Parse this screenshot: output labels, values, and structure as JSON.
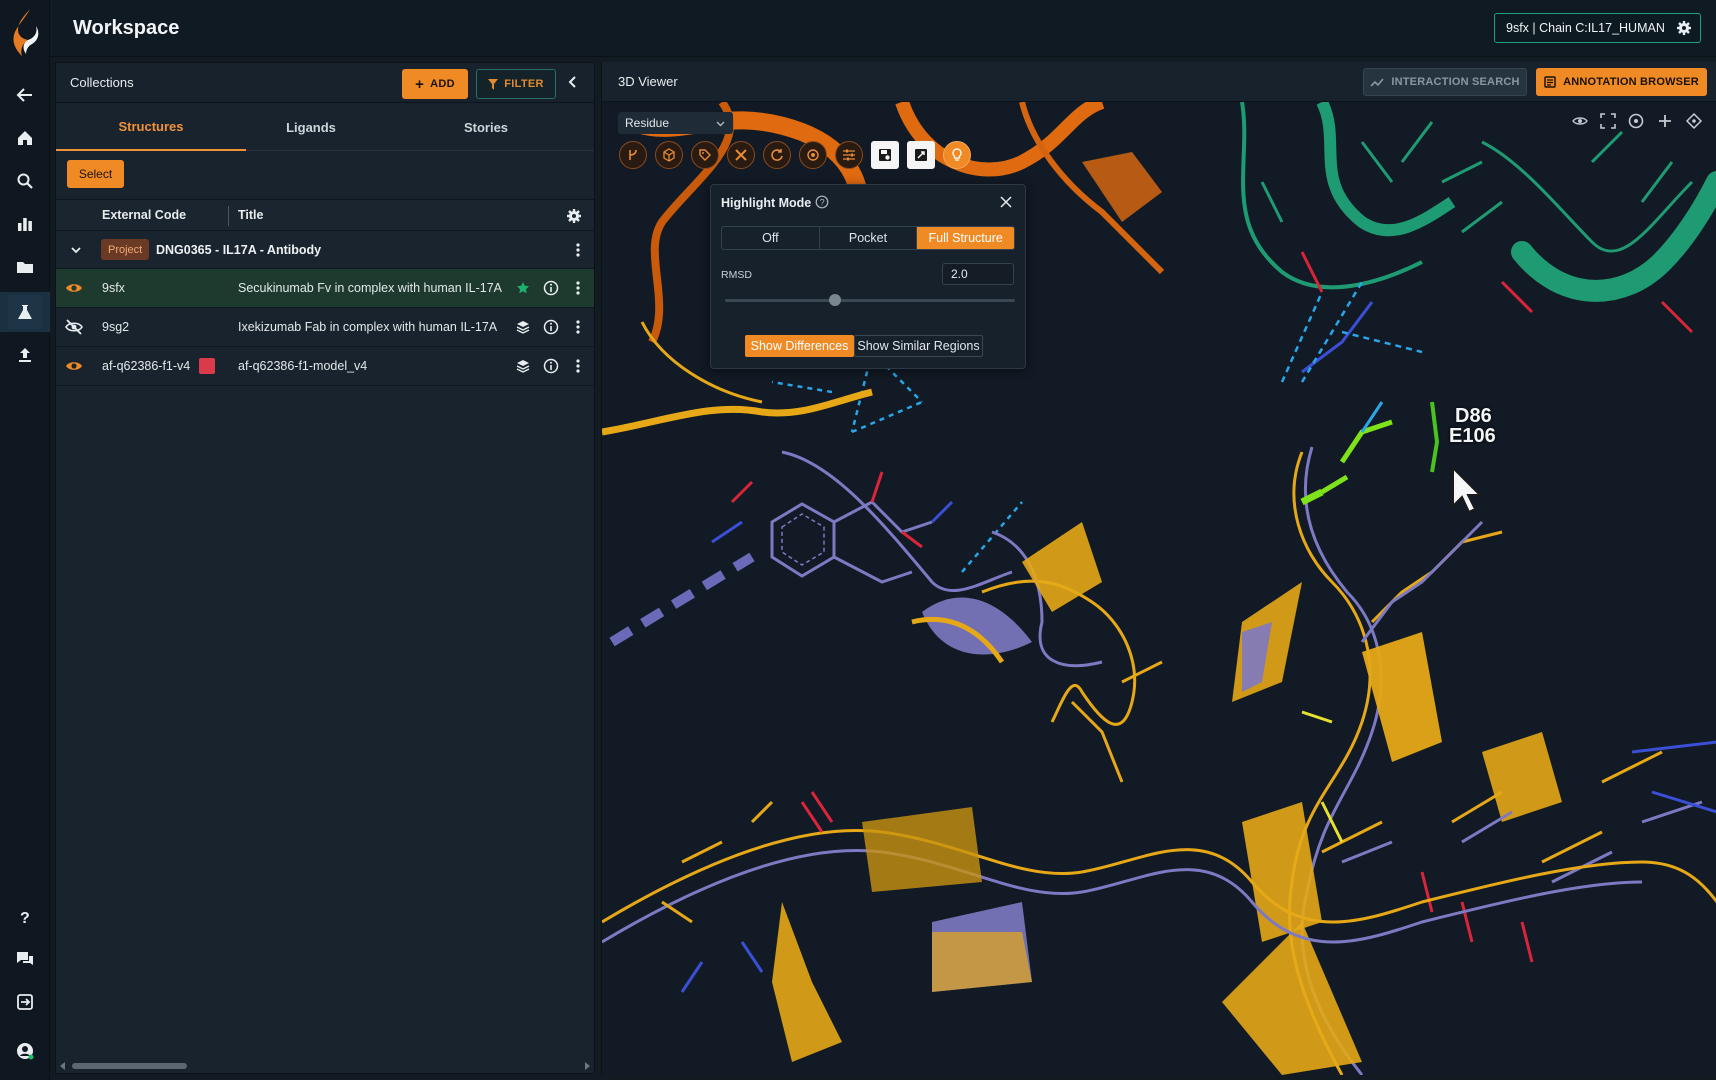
{
  "header": {
    "title": "Workspace",
    "context_badge": "9sfx | Chain C:IL17_HUMAN"
  },
  "collections": {
    "title": "Collections",
    "add_label": "ADD",
    "filter_label": "FILTER",
    "tabs": [
      "Structures",
      "Ligands",
      "Stories"
    ],
    "active_tab": "Structures",
    "select_label": "Select",
    "columns": {
      "external_code": "External Code",
      "title": "Title"
    },
    "project": {
      "tag": "Project",
      "name": "DNG0365 - IL17A - Antibody"
    },
    "rows": [
      {
        "code": "9sfx",
        "title": "Secukinumab Fv in complex with human IL-17A",
        "visible": true,
        "starred": true,
        "selected": true
      },
      {
        "code": "9sg2",
        "title": "Ixekizumab Fab in complex with human IL-17A",
        "visible": false,
        "starred": false,
        "selected": false
      },
      {
        "code": "af-q62386-f1-v4",
        "title": "af-q62386-f1-model_v4",
        "visible": true,
        "starred": false,
        "selected": false,
        "model_icon": true
      }
    ]
  },
  "viewer": {
    "title": "3D Viewer",
    "interaction_search_label": "INTERACTION SEARCH",
    "annotation_browser_label": "ANNOTATION BROWSER",
    "selection_mode": "Residue",
    "residue_labels": [
      "D86",
      "E106"
    ]
  },
  "highlight_mode": {
    "title": "Highlight Mode",
    "options": [
      "Off",
      "Pocket",
      "Full Structure"
    ],
    "active_option": "Full Structure",
    "rmsd_label": "RMSD",
    "rmsd_value": "2.0",
    "rmsd_slider_fraction": 0.38,
    "show_differences_label": "Show Differences",
    "show_similar_label": "Show Similar Regions"
  },
  "colors": {
    "accent": "#f08a24",
    "badge_border": "#1aa37a",
    "structure_gold": "#e6a817",
    "structure_lavender": "#7d79c2",
    "structure_orange": "#e06a10",
    "structure_teal": "#1e9b72"
  }
}
